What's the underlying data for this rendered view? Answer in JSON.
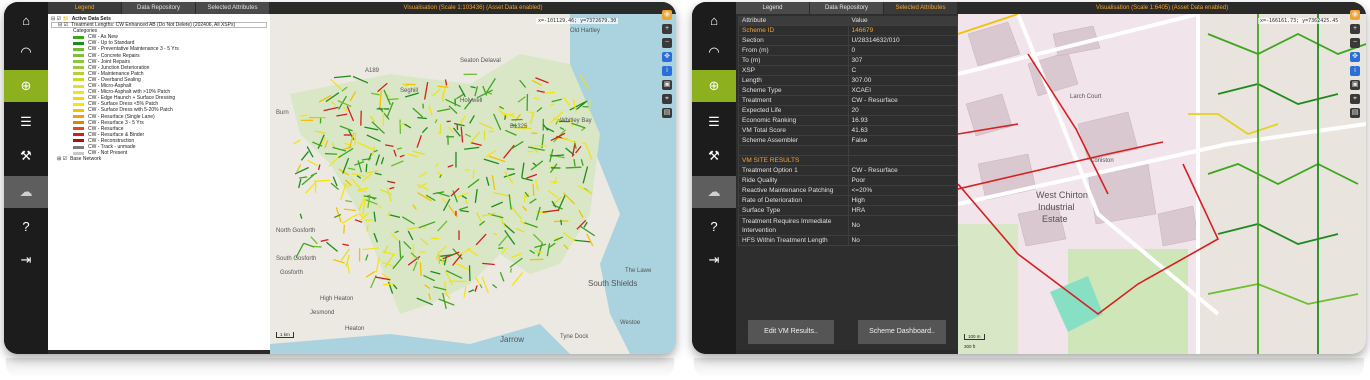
{
  "rail": {
    "items": [
      {
        "icon": "home-icon"
      },
      {
        "icon": "speedometer-icon"
      },
      {
        "icon": "globe-icon"
      },
      {
        "icon": "database-icon"
      },
      {
        "icon": "road-worker-icon"
      },
      {
        "icon": "cloud-icon"
      },
      {
        "icon": "help-icon"
      },
      {
        "icon": "logout-icon"
      }
    ]
  },
  "left_window": {
    "tabs": [
      "Legend",
      "Data Repository",
      "Selected Attributes"
    ],
    "map_title": "Visualisation (Scale 1:103436)   (Asset Data enabled)",
    "coords": "x=-101129.46; y=7372679.30",
    "legend": {
      "root": "Active Data Sets",
      "dataset": "Treatment Lengths: CW Enhanced AB (Do Not Delete) (202406, All XSPs)",
      "categories_label": "Categories",
      "categories": [
        {
          "label": "CW - As New",
          "color": "#3fa51f"
        },
        {
          "label": "CW - Up to Standard",
          "color": "#1f8b1f"
        },
        {
          "label": "CW - Preventative Maintenance 3 - 5 Yrs",
          "color": "#6dbf2b"
        },
        {
          "label": "CW - Concrete Repairs",
          "color": "#7ebf3a"
        },
        {
          "label": "CW - Joint Repairs",
          "color": "#8ec63f"
        },
        {
          "label": "CW - Junction Deterioration",
          "color": "#9ccc3d"
        },
        {
          "label": "CW - Maintenance Patch",
          "color": "#b4d235"
        },
        {
          "label": "CW - Overband Sealing",
          "color": "#c8d92e"
        },
        {
          "label": "CW - Micro-Asphalt",
          "color": "#e2e02a"
        },
        {
          "label": "CW - Micro-Asphalt with >10% Patch",
          "color": "#f0e41e"
        },
        {
          "label": "CW - Edge Haunch + Surface Dressing",
          "color": "#f5d800"
        },
        {
          "label": "CW - Surface Dress <5% Patch",
          "color": "#f7e600"
        },
        {
          "label": "CW - Surface Dress with 5-20% Patch",
          "color": "#f2c200"
        },
        {
          "label": "CW - Resurface (Single Lane)",
          "color": "#f0a000"
        },
        {
          "label": "CW - Resurface 3 - 5 Yrs",
          "color": "#e98000"
        },
        {
          "label": "CW - Resurface",
          "color": "#e04a1a"
        },
        {
          "label": "CW - Resurface & Binder",
          "color": "#d21f1f"
        },
        {
          "label": "CW - Reconstruction",
          "color": "#b00f0f"
        },
        {
          "label": "CW - Track - unmade",
          "color": "#7a7a7a"
        },
        {
          "label": "CW - Not Present",
          "color": "#c9c9c9"
        }
      ],
      "base_layer": "Base Network"
    },
    "map_labels": [
      "A189",
      "Old Hartley",
      "Seaton Delaval",
      "Seghill",
      "Holywell",
      "Burn",
      "B1325",
      "Whitley Bay",
      "North Gosforth",
      "South Gosforth",
      "Gosforth",
      "High Heaton",
      "Jesmond",
      "Heaton",
      "The Lawe",
      "South Shields",
      "Westoe",
      "Tyne Dock",
      "Jarrow"
    ],
    "scale_text": "1 km"
  },
  "right_window": {
    "tabs": [
      "Legend",
      "Data Repository",
      "Selected Attributes"
    ],
    "map_title": "Visualisation (Scale 1:6405)   (Asset Data enabled)",
    "coords": "x=-166161.73; y=7362425.45",
    "table_header": [
      "Attribute",
      "Value"
    ],
    "attributes": [
      {
        "k": "Scheme ID",
        "v": "146679",
        "highlight": true
      },
      {
        "k": "Section",
        "v": "U/28314632/010"
      },
      {
        "k": "From (m)",
        "v": "0"
      },
      {
        "k": "To (m)",
        "v": "307"
      },
      {
        "k": "XSP",
        "v": "C"
      },
      {
        "k": "Length",
        "v": "307.00"
      },
      {
        "k": "Scheme Type",
        "v": "XCAEI"
      },
      {
        "k": "Treatment",
        "v": "CW - Resurface"
      },
      {
        "k": "Expected Life",
        "v": "20"
      },
      {
        "k": "Economic Ranking",
        "v": "16.93"
      },
      {
        "k": "VM Total Score",
        "v": "41.63"
      },
      {
        "k": "Scheme Assembler",
        "v": "False"
      },
      {
        "k": "",
        "v": ""
      },
      {
        "k": "VM SITE RESULTS",
        "v": "",
        "highlight": true
      },
      {
        "k": "Treatment Option 1",
        "v": "CW - Resurface"
      },
      {
        "k": "Ride Quality",
        "v": "Poor"
      },
      {
        "k": "Reactive Maintenance Patching",
        "v": "<=20%"
      },
      {
        "k": "Rate of Deterioration",
        "v": "High"
      },
      {
        "k": "Surface Type",
        "v": "HRA"
      },
      {
        "k": "Treatment Requires Immediate Intervention",
        "v": "No",
        "tall": true
      },
      {
        "k": "HFS Within Treatment Length",
        "v": "No"
      }
    ],
    "buttons": {
      "edit": "Edit VM Results..",
      "dashboard": "Scheme Dashboard.."
    },
    "map_labels": [
      "West Chirton",
      "Industrial",
      "Estate",
      "Larch Court",
      "Coniston"
    ],
    "scale_text": [
      "100 m",
      "300 ft"
    ]
  }
}
